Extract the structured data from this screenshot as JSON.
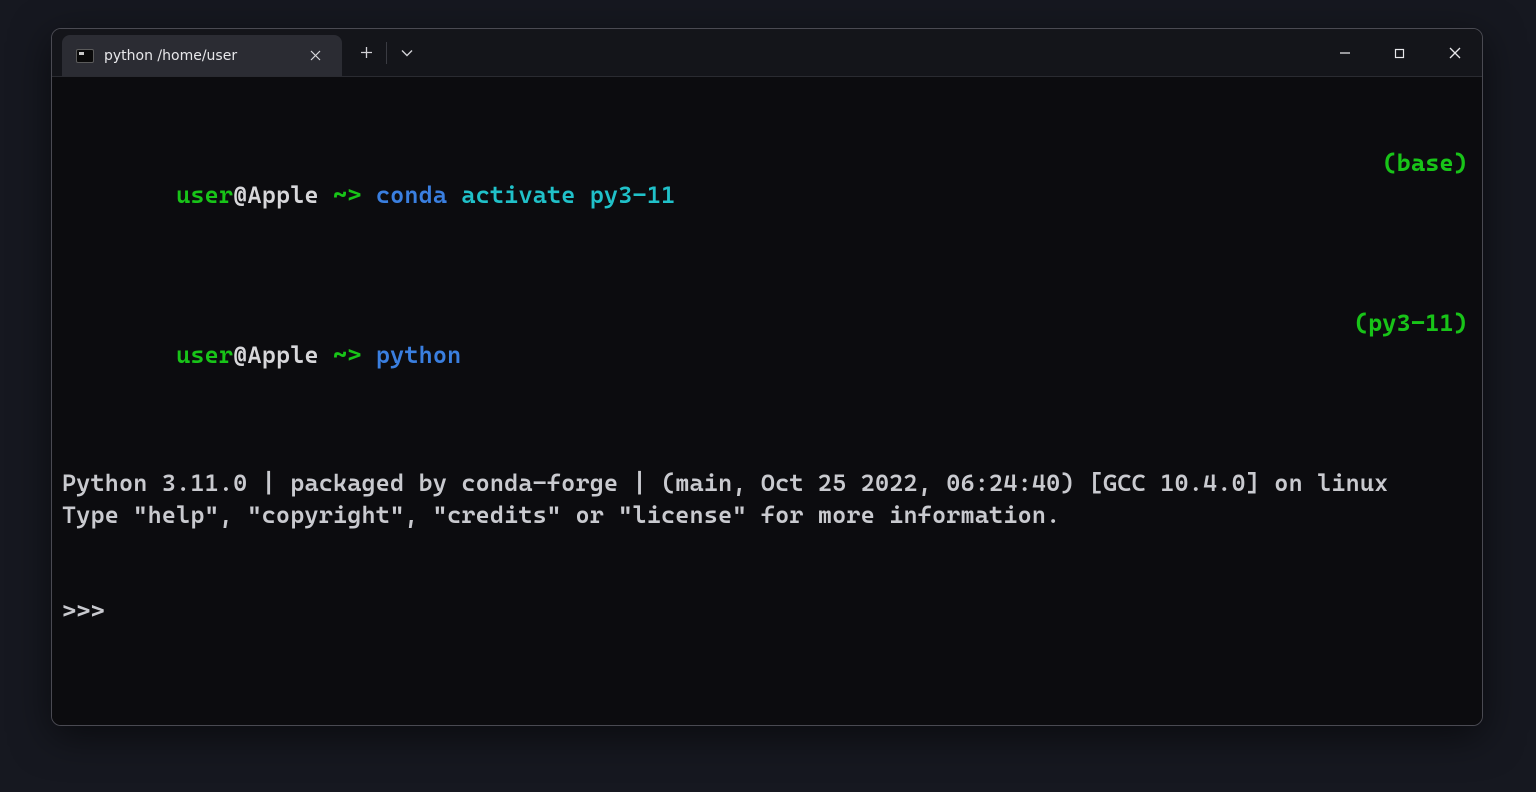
{
  "titlebar": {
    "tab_title": "python /home/user"
  },
  "terminal": {
    "lines": [
      {
        "user": "user",
        "at": "@",
        "host": "Apple",
        "path": " ~",
        "sep": "> ",
        "cmd": "conda",
        "space1": " ",
        "sub": "activate",
        "space2": " ",
        "arg": "py3-11",
        "env": "(base)"
      },
      {
        "user": "user",
        "at": "@",
        "host": "Apple",
        "path": " ~",
        "sep": "> ",
        "cmd": "python",
        "env": "(py3-11)"
      }
    ],
    "output": "Python 3.11.0 | packaged by conda-forge | (main, Oct 25 2022, 06:24:40) [GCC 10.4.0] on linux\nType \"help\", \"copyright\", \"credits\" or \"license\" for more information.",
    "repl_prompt": ">>> "
  }
}
